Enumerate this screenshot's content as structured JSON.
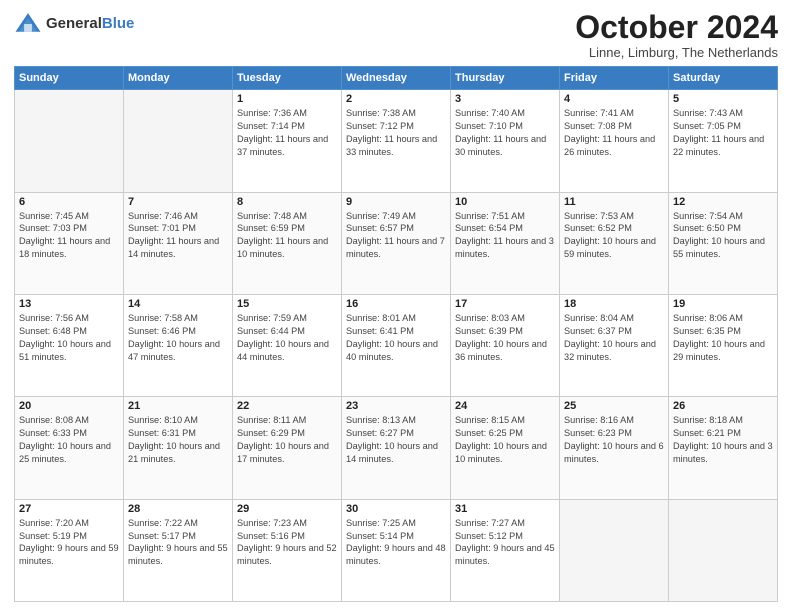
{
  "header": {
    "logo_general": "General",
    "logo_blue": "Blue",
    "month_title": "October 2024",
    "location": "Linne, Limburg, The Netherlands"
  },
  "weekdays": [
    "Sunday",
    "Monday",
    "Tuesday",
    "Wednesday",
    "Thursday",
    "Friday",
    "Saturday"
  ],
  "weeks": [
    [
      {
        "day": "",
        "sunrise": "",
        "sunset": "",
        "daylight": "",
        "empty": true
      },
      {
        "day": "",
        "sunrise": "",
        "sunset": "",
        "daylight": "",
        "empty": true
      },
      {
        "day": "1",
        "sunrise": "Sunrise: 7:36 AM",
        "sunset": "Sunset: 7:14 PM",
        "daylight": "Daylight: 11 hours and 37 minutes.",
        "empty": false
      },
      {
        "day": "2",
        "sunrise": "Sunrise: 7:38 AM",
        "sunset": "Sunset: 7:12 PM",
        "daylight": "Daylight: 11 hours and 33 minutes.",
        "empty": false
      },
      {
        "day": "3",
        "sunrise": "Sunrise: 7:40 AM",
        "sunset": "Sunset: 7:10 PM",
        "daylight": "Daylight: 11 hours and 30 minutes.",
        "empty": false
      },
      {
        "day": "4",
        "sunrise": "Sunrise: 7:41 AM",
        "sunset": "Sunset: 7:08 PM",
        "daylight": "Daylight: 11 hours and 26 minutes.",
        "empty": false
      },
      {
        "day": "5",
        "sunrise": "Sunrise: 7:43 AM",
        "sunset": "Sunset: 7:05 PM",
        "daylight": "Daylight: 11 hours and 22 minutes.",
        "empty": false
      }
    ],
    [
      {
        "day": "6",
        "sunrise": "Sunrise: 7:45 AM",
        "sunset": "Sunset: 7:03 PM",
        "daylight": "Daylight: 11 hours and 18 minutes.",
        "empty": false
      },
      {
        "day": "7",
        "sunrise": "Sunrise: 7:46 AM",
        "sunset": "Sunset: 7:01 PM",
        "daylight": "Daylight: 11 hours and 14 minutes.",
        "empty": false
      },
      {
        "day": "8",
        "sunrise": "Sunrise: 7:48 AM",
        "sunset": "Sunset: 6:59 PM",
        "daylight": "Daylight: 11 hours and 10 minutes.",
        "empty": false
      },
      {
        "day": "9",
        "sunrise": "Sunrise: 7:49 AM",
        "sunset": "Sunset: 6:57 PM",
        "daylight": "Daylight: 11 hours and 7 minutes.",
        "empty": false
      },
      {
        "day": "10",
        "sunrise": "Sunrise: 7:51 AM",
        "sunset": "Sunset: 6:54 PM",
        "daylight": "Daylight: 11 hours and 3 minutes.",
        "empty": false
      },
      {
        "day": "11",
        "sunrise": "Sunrise: 7:53 AM",
        "sunset": "Sunset: 6:52 PM",
        "daylight": "Daylight: 10 hours and 59 minutes.",
        "empty": false
      },
      {
        "day": "12",
        "sunrise": "Sunrise: 7:54 AM",
        "sunset": "Sunset: 6:50 PM",
        "daylight": "Daylight: 10 hours and 55 minutes.",
        "empty": false
      }
    ],
    [
      {
        "day": "13",
        "sunrise": "Sunrise: 7:56 AM",
        "sunset": "Sunset: 6:48 PM",
        "daylight": "Daylight: 10 hours and 51 minutes.",
        "empty": false
      },
      {
        "day": "14",
        "sunrise": "Sunrise: 7:58 AM",
        "sunset": "Sunset: 6:46 PM",
        "daylight": "Daylight: 10 hours and 47 minutes.",
        "empty": false
      },
      {
        "day": "15",
        "sunrise": "Sunrise: 7:59 AM",
        "sunset": "Sunset: 6:44 PM",
        "daylight": "Daylight: 10 hours and 44 minutes.",
        "empty": false
      },
      {
        "day": "16",
        "sunrise": "Sunrise: 8:01 AM",
        "sunset": "Sunset: 6:41 PM",
        "daylight": "Daylight: 10 hours and 40 minutes.",
        "empty": false
      },
      {
        "day": "17",
        "sunrise": "Sunrise: 8:03 AM",
        "sunset": "Sunset: 6:39 PM",
        "daylight": "Daylight: 10 hours and 36 minutes.",
        "empty": false
      },
      {
        "day": "18",
        "sunrise": "Sunrise: 8:04 AM",
        "sunset": "Sunset: 6:37 PM",
        "daylight": "Daylight: 10 hours and 32 minutes.",
        "empty": false
      },
      {
        "day": "19",
        "sunrise": "Sunrise: 8:06 AM",
        "sunset": "Sunset: 6:35 PM",
        "daylight": "Daylight: 10 hours and 29 minutes.",
        "empty": false
      }
    ],
    [
      {
        "day": "20",
        "sunrise": "Sunrise: 8:08 AM",
        "sunset": "Sunset: 6:33 PM",
        "daylight": "Daylight: 10 hours and 25 minutes.",
        "empty": false
      },
      {
        "day": "21",
        "sunrise": "Sunrise: 8:10 AM",
        "sunset": "Sunset: 6:31 PM",
        "daylight": "Daylight: 10 hours and 21 minutes.",
        "empty": false
      },
      {
        "day": "22",
        "sunrise": "Sunrise: 8:11 AM",
        "sunset": "Sunset: 6:29 PM",
        "daylight": "Daylight: 10 hours and 17 minutes.",
        "empty": false
      },
      {
        "day": "23",
        "sunrise": "Sunrise: 8:13 AM",
        "sunset": "Sunset: 6:27 PM",
        "daylight": "Daylight: 10 hours and 14 minutes.",
        "empty": false
      },
      {
        "day": "24",
        "sunrise": "Sunrise: 8:15 AM",
        "sunset": "Sunset: 6:25 PM",
        "daylight": "Daylight: 10 hours and 10 minutes.",
        "empty": false
      },
      {
        "day": "25",
        "sunrise": "Sunrise: 8:16 AM",
        "sunset": "Sunset: 6:23 PM",
        "daylight": "Daylight: 10 hours and 6 minutes.",
        "empty": false
      },
      {
        "day": "26",
        "sunrise": "Sunrise: 8:18 AM",
        "sunset": "Sunset: 6:21 PM",
        "daylight": "Daylight: 10 hours and 3 minutes.",
        "empty": false
      }
    ],
    [
      {
        "day": "27",
        "sunrise": "Sunrise: 7:20 AM",
        "sunset": "Sunset: 5:19 PM",
        "daylight": "Daylight: 9 hours and 59 minutes.",
        "empty": false
      },
      {
        "day": "28",
        "sunrise": "Sunrise: 7:22 AM",
        "sunset": "Sunset: 5:17 PM",
        "daylight": "Daylight: 9 hours and 55 minutes.",
        "empty": false
      },
      {
        "day": "29",
        "sunrise": "Sunrise: 7:23 AM",
        "sunset": "Sunset: 5:16 PM",
        "daylight": "Daylight: 9 hours and 52 minutes.",
        "empty": false
      },
      {
        "day": "30",
        "sunrise": "Sunrise: 7:25 AM",
        "sunset": "Sunset: 5:14 PM",
        "daylight": "Daylight: 9 hours and 48 minutes.",
        "empty": false
      },
      {
        "day": "31",
        "sunrise": "Sunrise: 7:27 AM",
        "sunset": "Sunset: 5:12 PM",
        "daylight": "Daylight: 9 hours and 45 minutes.",
        "empty": false
      },
      {
        "day": "",
        "sunrise": "",
        "sunset": "",
        "daylight": "",
        "empty": true
      },
      {
        "day": "",
        "sunrise": "",
        "sunset": "",
        "daylight": "",
        "empty": true
      }
    ]
  ]
}
